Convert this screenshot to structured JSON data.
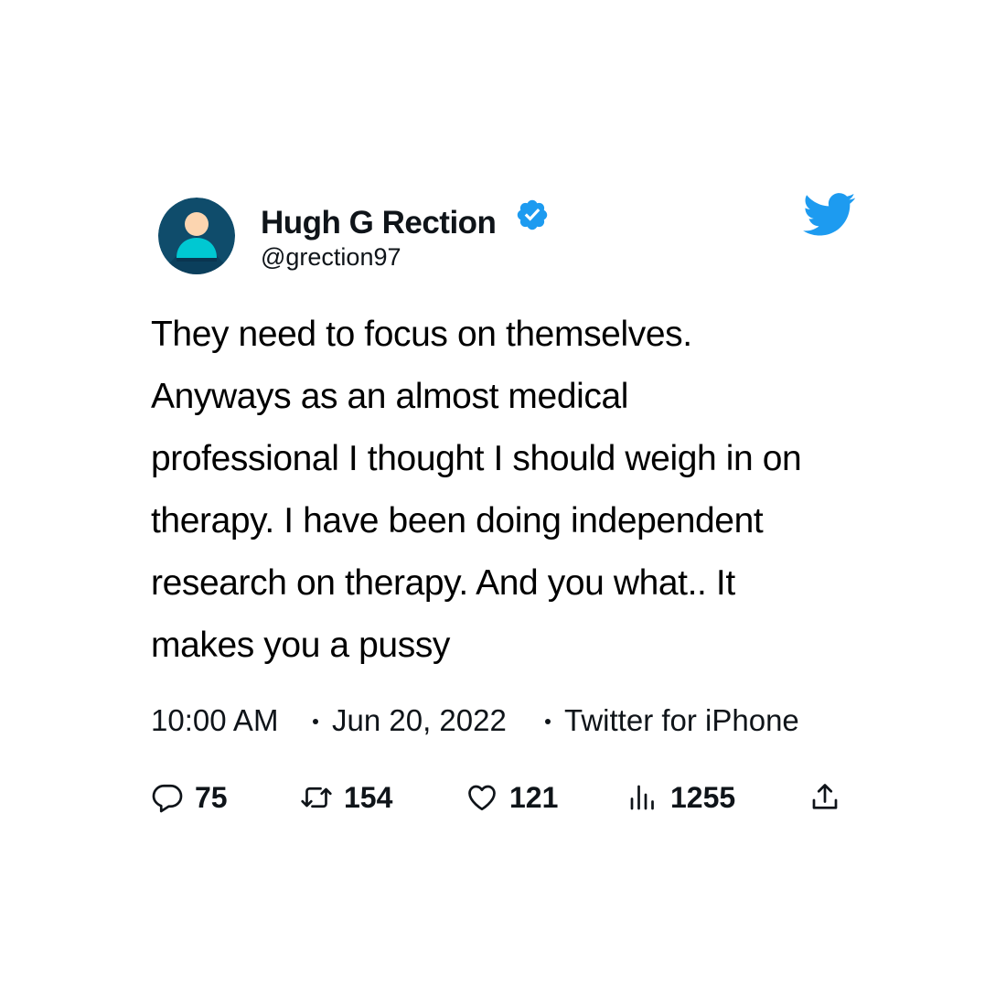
{
  "author": {
    "display_name": "Hugh G Rection",
    "handle": "@grection97",
    "verified_icon": "verified-badge-icon",
    "avatar_icon": "default-avatar-icon"
  },
  "platform_icon": "twitter-bird-icon",
  "tweet": {
    "lines": [
      "They need to focus on themselves.",
      "Anyways as an almost medical",
      "professional I thought I should weigh in on",
      "therapy. I have been doing independent",
      "research on therapy. And you what.. It",
      "makes you a pussy"
    ]
  },
  "meta": {
    "time": "10:00 AM",
    "date": "Jun 20, 2022",
    "source": "Twitter for iPhone"
  },
  "actions": {
    "replies": "75",
    "retweets": "154",
    "likes": "121",
    "views": "1255"
  },
  "colors": {
    "twitter_blue": "#1d9bf0",
    "text": "#0f1419",
    "avatar_bg": "#0f4c6b",
    "avatar_body": "#00c8d2",
    "avatar_skin": "#fcd5b0"
  }
}
